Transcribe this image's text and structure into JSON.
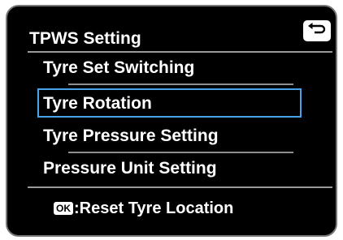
{
  "header": {
    "title": "TPWS Setting",
    "back_icon": "return-arrow-icon"
  },
  "menu": {
    "items": [
      {
        "label": "Tyre Set Switching",
        "selected": false
      },
      {
        "label": "Tyre Rotation",
        "selected": true
      },
      {
        "label": "Tyre Pressure Setting",
        "selected": false
      },
      {
        "label": "Pressure Unit Setting",
        "selected": false
      }
    ]
  },
  "footer": {
    "ok_key": "OK",
    "hint_text": ":Reset Tyre Location"
  },
  "colors": {
    "screen_bg": "#000000",
    "text": "#ffffff",
    "selection_border": "#4aa3e8"
  }
}
